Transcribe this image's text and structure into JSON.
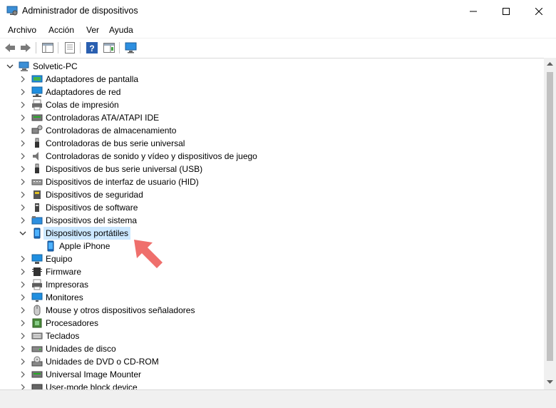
{
  "window": {
    "title": "Administrador de dispositivos"
  },
  "menu": {
    "items": [
      "Archivo",
      "Acción",
      "Ver",
      "Ayuda"
    ]
  },
  "tree": {
    "root": "Solvetic-PC",
    "categories": [
      {
        "label": "Adaptadores de pantalla",
        "icon": "display-adapter-icon"
      },
      {
        "label": "Adaptadores de red",
        "icon": "network-adapter-icon"
      },
      {
        "label": "Colas de impresión",
        "icon": "print-queue-icon"
      },
      {
        "label": "Controladoras ATA/ATAPI IDE",
        "icon": "ide-controller-icon"
      },
      {
        "label": "Controladoras de almacenamiento",
        "icon": "storage-controller-icon"
      },
      {
        "label": "Controladoras de bus serie universal",
        "icon": "usb-icon"
      },
      {
        "label": "Controladoras de sonido y vídeo y dispositivos de juego",
        "icon": "speaker-icon"
      },
      {
        "label": "Dispositivos de bus serie universal (USB)",
        "icon": "usb-icon"
      },
      {
        "label": "Dispositivos de interfaz de usuario (HID)",
        "icon": "hid-icon"
      },
      {
        "label": "Dispositivos de seguridad",
        "icon": "security-device-icon"
      },
      {
        "label": "Dispositivos de software",
        "icon": "software-device-icon"
      },
      {
        "label": "Dispositivos del sistema",
        "icon": "system-device-icon"
      },
      {
        "label": "Dispositivos portátiles",
        "icon": "portable-device-icon",
        "expanded": true,
        "children": [
          {
            "label": "Apple iPhone",
            "icon": "phone-icon"
          }
        ]
      },
      {
        "label": "Equipo",
        "icon": "computer-icon"
      },
      {
        "label": "Firmware",
        "icon": "firmware-icon"
      },
      {
        "label": "Impresoras",
        "icon": "printer-icon"
      },
      {
        "label": "Monitores",
        "icon": "monitor-icon"
      },
      {
        "label": "Mouse y otros dispositivos señaladores",
        "icon": "mouse-icon"
      },
      {
        "label": "Procesadores",
        "icon": "processor-icon"
      },
      {
        "label": "Teclados",
        "icon": "keyboard-icon"
      },
      {
        "label": "Unidades de disco",
        "icon": "disk-drive-icon"
      },
      {
        "label": "Unidades de DVD o CD-ROM",
        "icon": "dvd-drive-icon"
      },
      {
        "label": "Universal Image Mounter",
        "icon": "image-mounter-icon"
      },
      {
        "label": "User-mode block device",
        "icon": "block-device-icon"
      }
    ]
  },
  "colors": {
    "selection": "#cce8ff",
    "accent": "#0078d7",
    "arrow": "#ef6f6c"
  }
}
